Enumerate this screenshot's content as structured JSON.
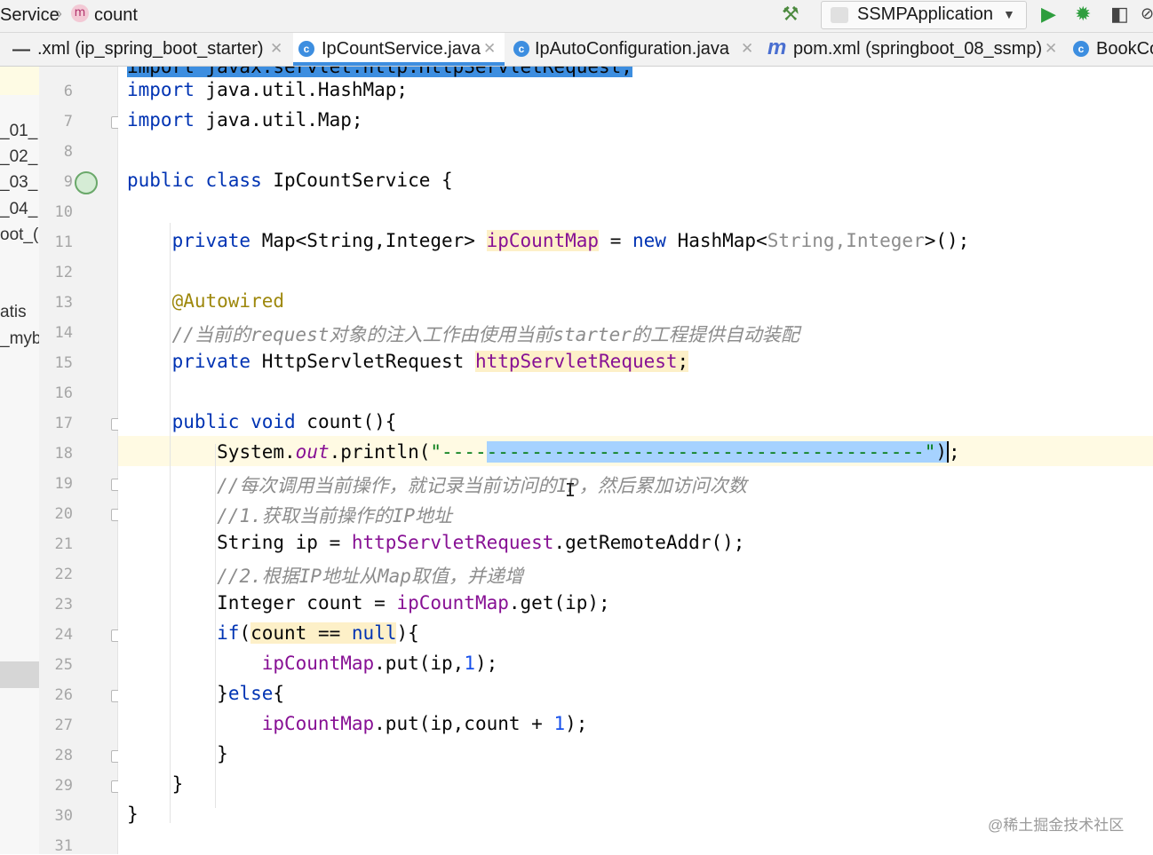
{
  "breadcrumb": {
    "service": "Service",
    "method_badge": "m",
    "method": "count"
  },
  "toolbar": {
    "run_config": "SSMPApplication",
    "build_icon": "hammer-icon",
    "run_icon": "run-icon",
    "debug_icon": "debug-icon",
    "coverage_icon": "coverage-icon",
    "colors": {
      "run": "#2e9e3e",
      "debug": "#2e9e3e",
      "accent": "#3d8ee0"
    }
  },
  "tabs": [
    {
      "label": ".xml (ip_spring_boot_starter)",
      "icon": "none",
      "active": false
    },
    {
      "label": "IpCountService.java",
      "icon": "c",
      "active": true
    },
    {
      "label": "IpAutoConfiguration.java",
      "icon": "c",
      "active": false
    },
    {
      "label": "pom.xml (springboot_08_ssmp)",
      "icon": "m",
      "active": false
    },
    {
      "label": "BookCo",
      "icon": "c",
      "active": false
    }
  ],
  "project_tree": [
    "_01_",
    "_02_",
    "_03_",
    "_04_",
    "oot_(",
    "atis",
    "_myb"
  ],
  "editor": {
    "partial_top_line": "import javax.servlet.http.HttpServletRequest;",
    "line_numbers": [
      "6",
      "7",
      "8",
      "9",
      "10",
      "11",
      "12",
      "13",
      "14",
      "15",
      "16",
      "17",
      "18",
      "19",
      "20",
      "21",
      "22",
      "23",
      "24",
      "25",
      "26",
      "27",
      "28",
      "29",
      "30",
      "31"
    ],
    "code": {
      "l6_kw": "import",
      "l6_rest": " java.util.HashMap;",
      "l7_kw": "import",
      "l7_rest": " java.util.Map;",
      "l9_kw": "public class",
      "l9_rest": " IpCountService {",
      "l11_kw": "private",
      "l11_type": " Map<String,Integer> ",
      "l11_field": "ipCountMap",
      "l11_eq": " = ",
      "l11_new": "new",
      "l11_tail_a": " HashMap<",
      "l11_tail_gen": "String,Integer",
      "l11_tail_b": ">();",
      "l13_ann": "@Autowired",
      "l14_cmt": "//当前的request对象的注入工作由使用当前starter的工程提供自动装配",
      "l15_kw": "private",
      "l15_type": " HttpServletRequest ",
      "l15_field": "httpServletRequest",
      "l15_end": ";",
      "l17_kw": "public void",
      "l17_rest": " count(){",
      "l18_a": "System.",
      "l18_out": "out",
      "l18_b": ".println(",
      "l18_str1": "\"----",
      "l18_sel": "---------------------------------------",
      "l18_str2": "\"",
      "l18_c": ")",
      "l18_end": ";",
      "l19_cmt": "//每次调用当前操作，就记录当前访问的IP，然后累加访问次数",
      "l20_cmt": "//1.获取当前操作的IP地址",
      "l21_a": "String ip = ",
      "l21_field": "httpServletRequest",
      "l21_b": ".getRemoteAddr();",
      "l22_cmt": "//2.根据IP地址从Map取值，并递增",
      "l23_a": "Integer count = ",
      "l23_field": "ipCountMap",
      "l23_b": ".get(ip);",
      "l24_kw": "if",
      "l24_a": "(",
      "l24_hl": "count == ",
      "l24_null": "null",
      "l24_b": "){",
      "l25_field": "ipCountMap",
      "l25_a": ".put(ip,",
      "l25_num": "1",
      "l25_b": ");",
      "l26_a": "}",
      "l26_kw": "else",
      "l26_b": "{",
      "l27_field": "ipCountMap",
      "l27_a": ".put(ip,count + ",
      "l27_num": "1",
      "l27_b": ");",
      "l28": "}",
      "l29": "}",
      "l30": "}"
    }
  },
  "watermark": "@稀土掘金技术社区"
}
